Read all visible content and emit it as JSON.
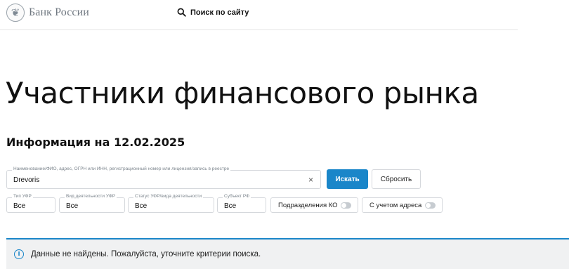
{
  "header": {
    "logo_text": "Банк России",
    "logo_icon": "eagle-emblem-icon",
    "search_label": "Поиск по сайту",
    "search_icon": "search-icon"
  },
  "page": {
    "title": "Участники финансового рынка",
    "info_date": "Информация на 12.02.2025"
  },
  "search_form": {
    "main_label": "Наименование/ФИО, адрес, ОГРН или ИНН, регистрационный номер или лицензия/запись в реестре",
    "main_value": "Drevoris",
    "clear_icon": "close-icon",
    "search_button": "Искать",
    "reset_button": "Сбросить"
  },
  "filters": [
    {
      "label": "Тип УФР",
      "value": "Все"
    },
    {
      "label": "Вид деятельности УФР",
      "value": "Все"
    },
    {
      "label": "Статус УФР/вида деятельности",
      "value": "Все"
    },
    {
      "label": "Субъект РФ",
      "value": "Все"
    }
  ],
  "toggles": [
    {
      "label": "Подразделения КО",
      "on": false
    },
    {
      "label": "С учетом адреса",
      "on": false
    }
  ],
  "alert": {
    "icon": "info-icon",
    "text": "Данные не найдены. Пожалуйста, уточните критерии поиска.",
    "accent_color": "#1a86c9"
  },
  "colors": {
    "primary": "#1a86c9",
    "alert_background": "#f0f1f2"
  }
}
